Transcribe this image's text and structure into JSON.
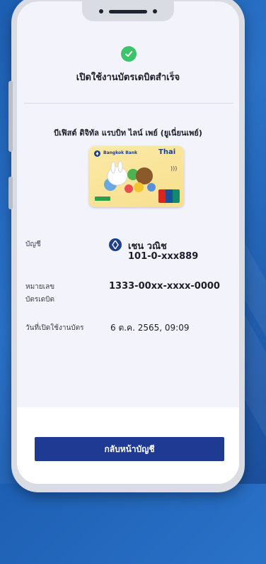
{
  "success": {
    "title": "เปิดใช้งานบัตรเดบิตสำเร็จ"
  },
  "card": {
    "name": "บีเฟิสต์ ดิจิทัล แรบบิท ไลน์ เพย์ (ยูเนี่ยนเพย์)",
    "bank_logo_text": "Bangkok Bank",
    "partner_logo_text": "Thai",
    "network": "UnionPay"
  },
  "details": {
    "account_label": "บัญชี",
    "account_holder": "เชน วณิช",
    "account_number": "101-0-xxx889",
    "card_number_label_line1": "หมายเลข",
    "card_number_label_line2": "บัตรเดบิต",
    "card_number": "1333-00xx-xxxx-0000",
    "activated_date_label": "วันที่เปิดใช้งานบัตร",
    "activated_date": "6 ต.ค. 2565, 09:09"
  },
  "actions": {
    "back_label": "กลับหน้าบัญชี"
  },
  "colors": {
    "background": "#2a72c8",
    "primary_button": "#1f3a93",
    "success": "#3cc46a",
    "screen": "#f2f3fb"
  }
}
